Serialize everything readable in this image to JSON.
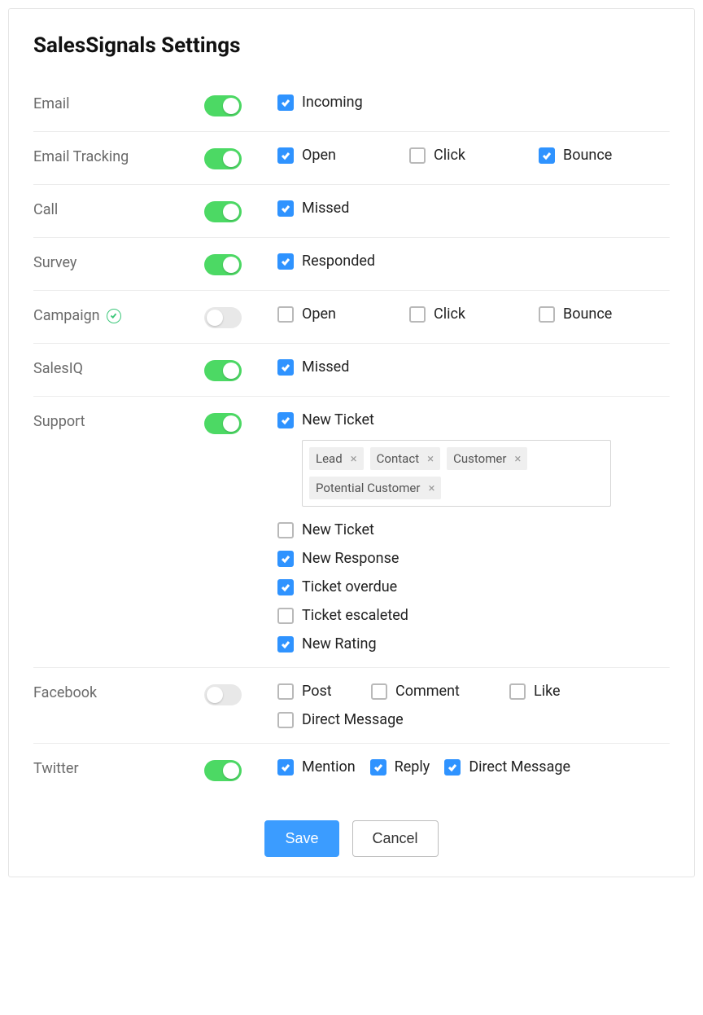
{
  "title": "SalesSignals Settings",
  "rows": {
    "email": {
      "label": "Email",
      "toggle": true,
      "options": [
        {
          "label": "Incoming",
          "checked": true
        }
      ]
    },
    "email_tracking": {
      "label": "Email Tracking",
      "toggle": true,
      "options": [
        {
          "label": "Open",
          "checked": true
        },
        {
          "label": "Click",
          "checked": false
        },
        {
          "label": "Bounce",
          "checked": true
        }
      ]
    },
    "call": {
      "label": "Call",
      "toggle": true,
      "options": [
        {
          "label": "Missed",
          "checked": true
        }
      ]
    },
    "survey": {
      "label": "Survey",
      "toggle": true,
      "options": [
        {
          "label": "Responded",
          "checked": true
        }
      ]
    },
    "campaign": {
      "label": "Campaign",
      "verified": true,
      "toggle": false,
      "options": [
        {
          "label": "Open",
          "checked": false
        },
        {
          "label": "Click",
          "checked": false
        },
        {
          "label": "Bounce",
          "checked": false
        }
      ]
    },
    "salesiq": {
      "label": "SalesIQ",
      "toggle": true,
      "options": [
        {
          "label": "Missed",
          "checked": true
        }
      ]
    },
    "support": {
      "label": "Support",
      "toggle": true,
      "main": {
        "label": "New Ticket",
        "checked": true
      },
      "tags": [
        "Lead",
        "Contact",
        "Customer",
        "Potential Customer"
      ],
      "sub": [
        {
          "label": "New Ticket",
          "checked": false
        },
        {
          "label": "New Response",
          "checked": true
        },
        {
          "label": "Ticket overdue",
          "checked": true
        },
        {
          "label": "Ticket escaleted",
          "checked": false
        },
        {
          "label": "New Rating",
          "checked": true
        }
      ]
    },
    "facebook": {
      "label": "Facebook",
      "toggle": false,
      "options": [
        {
          "label": "Post",
          "checked": false
        },
        {
          "label": "Comment",
          "checked": false
        },
        {
          "label": "Like",
          "checked": false
        },
        {
          "label": "Direct Message",
          "checked": false
        }
      ]
    },
    "twitter": {
      "label": "Twitter",
      "toggle": true,
      "options": [
        {
          "label": "Mention",
          "checked": true
        },
        {
          "label": "Reply",
          "checked": true
        },
        {
          "label": "Direct Message",
          "checked": true
        }
      ]
    }
  },
  "buttons": {
    "save": "Save",
    "cancel": "Cancel"
  }
}
